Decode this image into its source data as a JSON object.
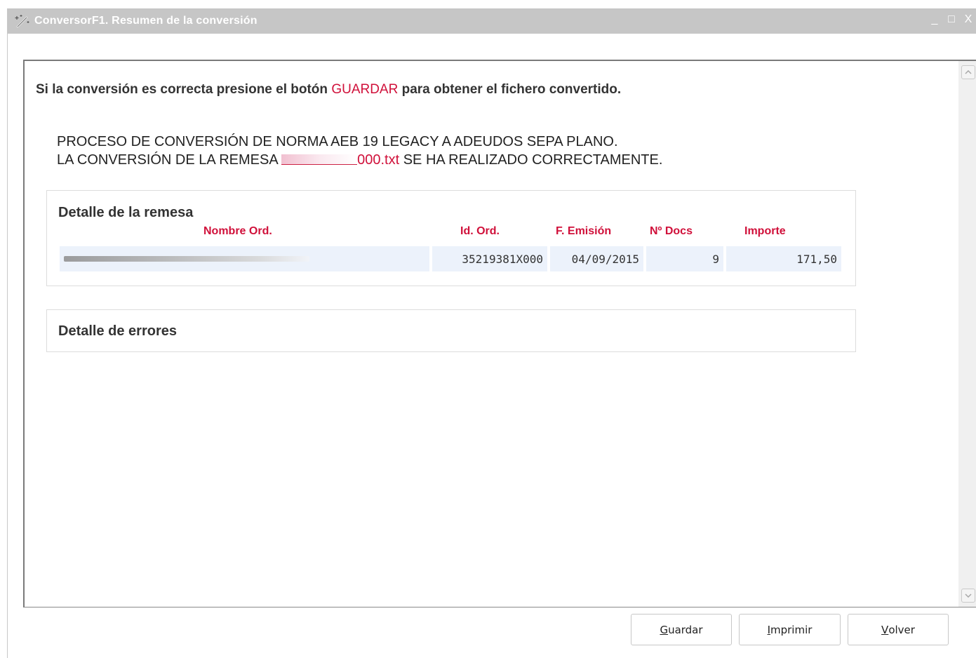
{
  "window": {
    "title": "ConversorF1. Resumen de la conversión",
    "controls": {
      "minimize": "_",
      "maximize": "□",
      "close": "X"
    }
  },
  "instruction": {
    "prefix": "Si la conversión es correcta presione el botón ",
    "highlight": "GUARDAR",
    "suffix": " para obtener el fichero convertido."
  },
  "process": {
    "line1": "PROCESO DE CONVERSIÓN DE NORMA AEB 19 LEGACY A ADEUDOS SEPA PLANO.",
    "line2_prefix": "LA CONVERSIÓN DE LA REMESA ",
    "file_suffix": "000.txt",
    "line2_suffix": " SE HA REALIZADO CORRECTAMENTE."
  },
  "remesa": {
    "title": "Detalle de la remesa",
    "columns": {
      "nombre": "Nombre Ord.",
      "id": "Id. Ord.",
      "fecha": "F. Emisión",
      "docs": "Nº Docs",
      "importe": "Importe"
    },
    "row": {
      "id": "35219381X000",
      "fecha": "04/09/2015",
      "docs": "9",
      "importe": "171,50"
    }
  },
  "errores": {
    "title": "Detalle de errores"
  },
  "buttons": {
    "guardar": {
      "first": "G",
      "rest": "uardar"
    },
    "imprimir": {
      "first": "I",
      "rest": "mprimir"
    },
    "volver": {
      "first": "V",
      "rest": "olver"
    }
  },
  "colors": {
    "titlebar": "#c6c6c6",
    "accent_red": "#d0103a",
    "row_bg": "#ecf2fb"
  }
}
